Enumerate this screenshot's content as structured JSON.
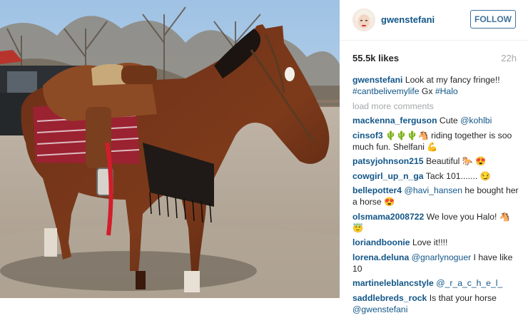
{
  "post": {
    "username": "gwenstefani",
    "follow_label": "FOLLOW",
    "likes": "55.5k likes",
    "time": "22h",
    "load_more": "load more comments"
  },
  "caption": {
    "user": "gwenstefani",
    "text": "Look at my fancy fringe!! ",
    "tag1": "#cantbelivemylife",
    "mid": " Gx ",
    "tag2": "#Halo"
  },
  "comments": [
    {
      "user": "mackenna_ferguson",
      "pre": "Cute ",
      "mention": "@kohlbi",
      "post": ""
    },
    {
      "user": "cinsof3",
      "pre": "🌵🌵🌵🐴 riding together is soo much fun. Shelfani 💪",
      "mention": "",
      "post": ""
    },
    {
      "user": "patsyjohnson215",
      "pre": "Beautiful 🐎 😍",
      "mention": "",
      "post": ""
    },
    {
      "user": "cowgirl_up_n_ga",
      "pre": "Tack 101....... 😏",
      "mention": "",
      "post": ""
    },
    {
      "user": "bellepotter4",
      "pre": "",
      "mention": "@havi_hansen",
      "post": " he bought her a horse 😍"
    },
    {
      "user": "olsmama2008722",
      "pre": "We love you Halo! 🐴 😇",
      "mention": "",
      "post": ""
    },
    {
      "user": "loriandboonie",
      "pre": "Love it!!!!",
      "mention": "",
      "post": ""
    },
    {
      "user": "lorena.deluna",
      "pre": "",
      "mention": "@gnarlynoguer",
      "post": " I have like 10"
    },
    {
      "user": "martineleblancstyle",
      "pre": "",
      "mention": "@_r_a_c_h_e_l_",
      "post": ""
    },
    {
      "user": "saddlebreds_rock",
      "pre": "Is that your horse ",
      "mention": "@gwenstefani",
      "post": ""
    }
  ],
  "colors": {
    "link": "#125688",
    "follow": "#3f729b",
    "muted": "#a5a7aa"
  }
}
